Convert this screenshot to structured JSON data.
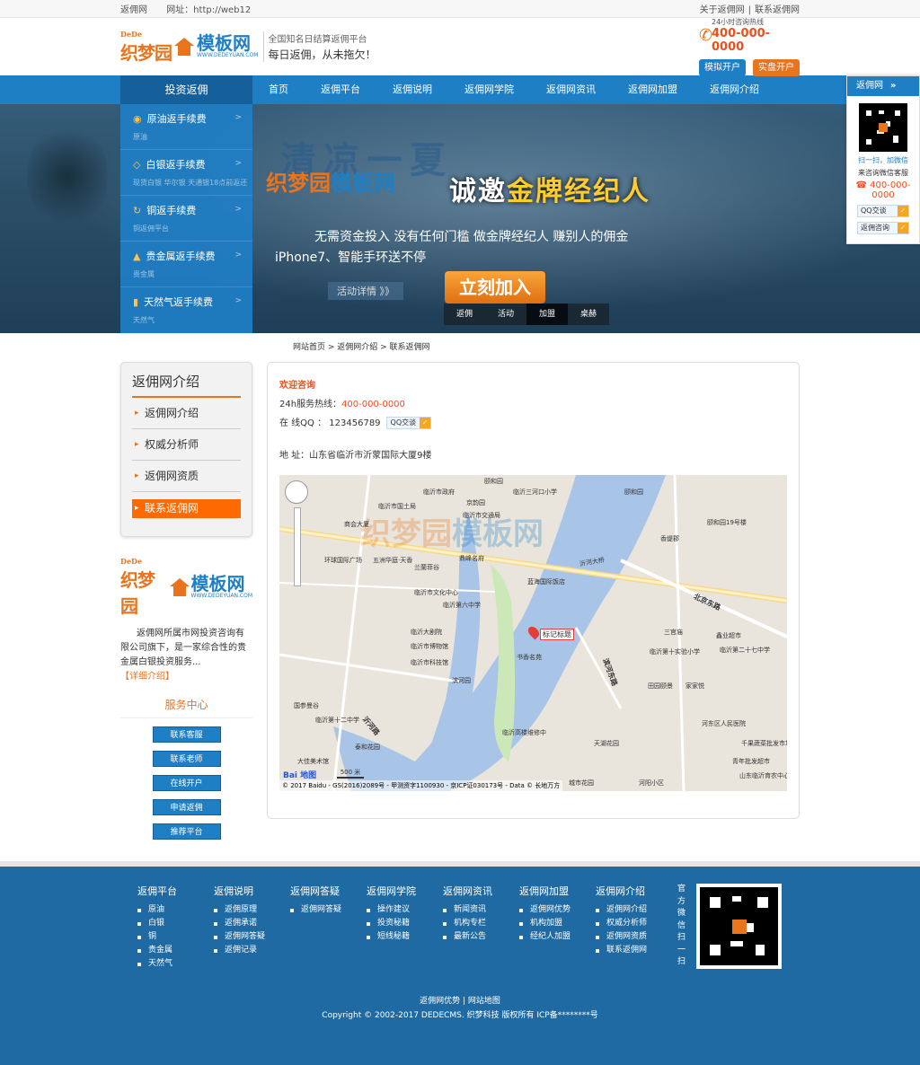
{
  "topbar": {
    "site": "返佣网",
    "url": "网址：http://web12",
    "about": "关于返佣网",
    "sep": "|",
    "contact": "联系返佣网"
  },
  "header": {
    "logo_dede": "DeDe",
    "logo_cn": "织梦园",
    "logo_mb": "模板网",
    "logo_url": "WWW.DEDEYUAN.COM",
    "slogan1": "全国知名日结算返佣平台",
    "slogan2": "每日返佣，从未拖欠！",
    "hotline_label": "24小时咨询热线",
    "hotline": "400-000-0000",
    "btn_sim": "模拟开户",
    "btn_real": "实盘开户"
  },
  "nav": {
    "invest": "投资返佣",
    "items": [
      "首页",
      "返佣平台",
      "返佣说明",
      "返佣网学院",
      "返佣网资讯",
      "返佣网加盟",
      "返佣网介绍"
    ]
  },
  "side_menu": [
    {
      "title": "原油返手续费",
      "sub": "原油",
      "icon": "globe-icon"
    },
    {
      "title": "白银返手续费",
      "sub": "现货白银 华尔银 天通银18点前返还",
      "icon": "diamond-icon"
    },
    {
      "title": "铜返手续费",
      "sub": "铜返佣平台",
      "icon": "refresh-icon"
    },
    {
      "title": "贵金属返手续费",
      "sub": "贵金属",
      "icon": "gold-icon"
    },
    {
      "title": "天然气返手续费",
      "sub": "天然气",
      "icon": "chart-icon"
    }
  ],
  "banner": {
    "big": "清凉一夏",
    "logo": "织梦园",
    "logo2": "模板网",
    "headline1": "诚邀",
    "headline2": "金牌经纪人",
    "sub1": "无需资金投入   没有任何门槛   做金牌经纪人   赚别人的佣金",
    "sub2": "iPhone7、智能手环送不停",
    "more": "活动详情 》》",
    "join": "立刻加入",
    "tabs": [
      "返佣",
      "活动",
      "加盟",
      "桌赫"
    ]
  },
  "float_qr": {
    "title": "返佣网",
    "scan": "扫一扫，加微信",
    "service": "来咨询微信客服",
    "tel": "400-000-0000",
    "qq": "QQ交谈",
    "consult": "返佣咨询"
  },
  "breadcrumb": "网站首页 > 返佣网介绍 > 联系返佣网",
  "left": {
    "title": "返佣网介绍",
    "items": [
      "返佣网介绍",
      "权威分析师",
      "返佣网资质",
      "联系返佣网"
    ],
    "desc": "返佣网所属市网投资咨询有限公司旗下，是一家综合性的贵金属白银投资服务...",
    "desc_link": "【详细介绍】",
    "service_title": "服务中心",
    "service_btns": [
      "联系客服",
      "联系老师",
      "在线开户",
      "申请返佣",
      "推荐平台"
    ]
  },
  "content": {
    "welcome": "欢迎咨询",
    "hotline_label": "24h服务热线：",
    "hotline": "400-000-0000",
    "qq_label": "在  线QQ ： 123456789",
    "qq_btn": "QQ交谈",
    "address": "地   址：山东省临沂市沂蒙国际大厦9楼"
  },
  "map": {
    "marker": "标记标题",
    "scale": "500 米",
    "copyright": "© 2017 Baidu - GS(2016)2089号 - 甲测资字1100930 - 京ICP证030173号 - Data © 长地万方",
    "logo": "Bai 地图",
    "labels": [
      "临沂市政府",
      "颐和园",
      "临沂市国土局",
      "京韵园",
      "临沂三河口小学",
      "颐和园",
      "临沂市交通局",
      "商会大厦",
      "环球国际广场",
      "五洲华庭·天香",
      "兰蘭菲谷",
      "鼎峰名府",
      "临沂市文化中心",
      "临沂第六中学",
      "蓝海国际饭店",
      "临沂大剧院",
      "临沂市博物馆",
      "临沂市科技馆",
      "滨河园",
      "书香名苑",
      "临沂高楼维修中",
      "临沂第十二中学",
      "泰和花园",
      "大佳美术馆",
      "三官庙",
      "临沂第十实验小学",
      "临沂第二十七中学",
      "田园颐景",
      "家家悦",
      "蒙农超市",
      "河东区人民医院",
      "天湖花园",
      "千果蔬菜批发市场",
      "青年批发超市",
      "山东临沂育农中心",
      "颐和园19号楼",
      "香缇郡",
      "河阳小区",
      "城市花园",
      "国参曼谷",
      "临沂第十二中学",
      "鑫业超市",
      "蒙河路"
    ],
    "roads": [
      "北京东路",
      "滨河东路",
      "沂河大桥",
      "沂河路"
    ]
  },
  "footer": {
    "cols": [
      {
        "title": "返佣平台",
        "items": [
          "原油",
          "白银",
          "铜",
          "贵金属",
          "天然气"
        ]
      },
      {
        "title": "返佣说明",
        "items": [
          "返佣原理",
          "返佣承诺",
          "返佣网答疑",
          "返佣记录"
        ]
      },
      {
        "title": "返佣网答疑",
        "items": [
          "返佣网答疑"
        ]
      },
      {
        "title": "返佣网学院",
        "items": [
          "操作建议",
          "投资秘籍",
          "短线秘籍"
        ]
      },
      {
        "title": "返佣网资讯",
        "items": [
          "新闻资讯",
          "机构专栏",
          "最新公告"
        ]
      },
      {
        "title": "返佣网加盟",
        "items": [
          "返佣网优势",
          "机构加盟",
          "经纪人加盟"
        ]
      },
      {
        "title": "返佣网介绍",
        "items": [
          "返佣网介绍",
          "权威分析师",
          "返佣网资质",
          "联系返佣网"
        ]
      }
    ],
    "wechat": "官方微信扫一扫",
    "links": "返佣网优势 | 网站地图",
    "copyright": "Copyright © 2002-2017 DEDECMS. 织梦科技 版权所有 ICP备********号"
  }
}
